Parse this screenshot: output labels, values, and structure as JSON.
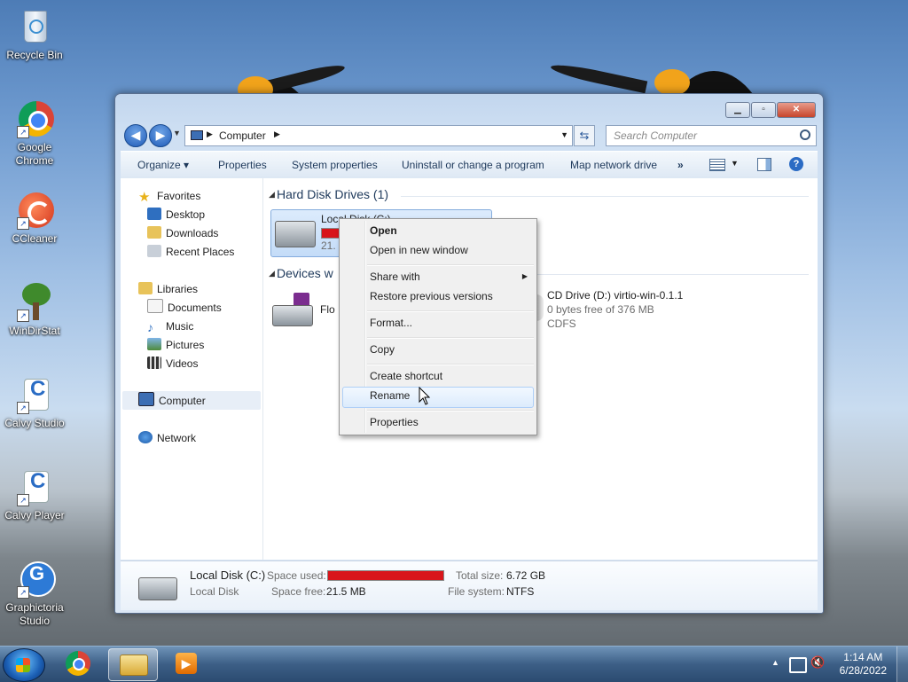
{
  "desktop": {
    "icons": [
      {
        "label": "Recycle Bin",
        "icon": "recycle-bin-icon"
      },
      {
        "label": "Google Chrome",
        "icon": "chrome-icon"
      },
      {
        "label": "CCleaner",
        "icon": "ccleaner-icon"
      },
      {
        "label": "WinDirStat",
        "icon": "windirstat-icon"
      },
      {
        "label": "Calvy Studio",
        "icon": "calvy-studio-icon"
      },
      {
        "label": "Calvy Player",
        "icon": "calvy-player-icon"
      },
      {
        "label": "Graphictoria Studio",
        "icon": "graphictoria-icon"
      }
    ]
  },
  "window": {
    "address": "Computer",
    "search_placeholder": "Search Computer",
    "toolbar": [
      "Organize",
      "Properties",
      "System properties",
      "Uninstall or change a program",
      "Map network drive",
      "»"
    ],
    "nav": {
      "favorites": "Favorites",
      "favorites_items": [
        "Desktop",
        "Downloads",
        "Recent Places"
      ],
      "libraries": "Libraries",
      "libraries_items": [
        "Documents",
        "Music",
        "Pictures",
        "Videos"
      ],
      "computer": "Computer",
      "network": "Network"
    },
    "groups": {
      "hdd": "Hard Disk Drives (1)",
      "devices": "Devices w"
    },
    "drives": {
      "local_disk": {
        "name": "Local Disk (C:)",
        "partial_free": "21.",
        "used_fraction": 0.997
      },
      "floppy": {
        "name": "Flo"
      },
      "cd": {
        "name": "CD Drive (D:) virtio-win-0.1.1",
        "free": "0 bytes free of 376 MB",
        "fs": "CDFS"
      }
    },
    "details": {
      "name": "Local Disk (C:)",
      "type": "Local Disk",
      "space_used_label": "Space used:",
      "space_free_label": "Space free:",
      "space_free": "21.5 MB",
      "total_size_label": "Total size:",
      "total_size": "6.72 GB",
      "fs_label": "File system:",
      "fs": "NTFS",
      "used_fraction": 0.997
    }
  },
  "context_menu": {
    "items": [
      "Open",
      "Open in new window",
      "Share with",
      "Restore previous versions",
      "Format...",
      "Copy",
      "Create shortcut",
      "Rename",
      "Properties"
    ],
    "highlighted": "Rename"
  },
  "taskbar": {
    "time": "1:14 AM",
    "date": "6/28/2022"
  },
  "colors": {
    "accent": "#1f5bb8",
    "used_bar": "#d8151b"
  }
}
